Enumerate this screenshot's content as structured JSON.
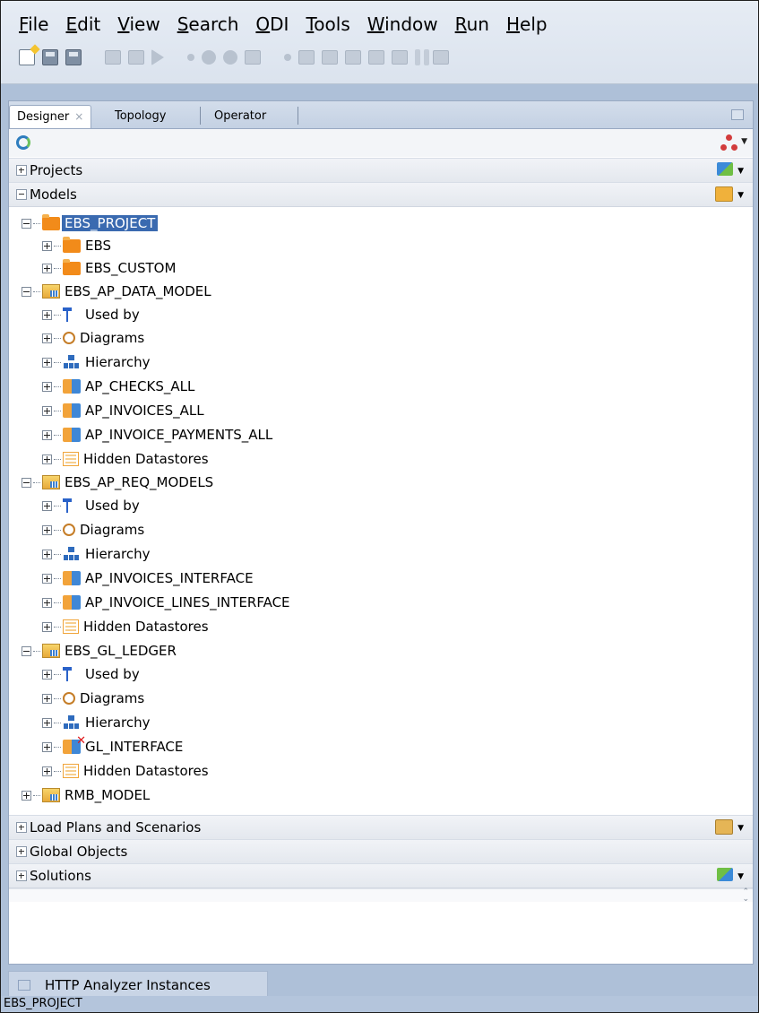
{
  "menu": [
    {
      "label": "File",
      "mnemonic": "F",
      "rest": "ile"
    },
    {
      "label": "Edit",
      "mnemonic": "E",
      "rest": "dit"
    },
    {
      "label": "View",
      "mnemonic": "V",
      "rest": "iew"
    },
    {
      "label": "Search",
      "mnemonic": "S",
      "rest": "earch"
    },
    {
      "label": "ODI",
      "mnemonic": "O",
      "rest": "DI"
    },
    {
      "label": "Tools",
      "mnemonic": "T",
      "rest": "ools"
    },
    {
      "label": "Window",
      "mnemonic": "W",
      "rest": "indow"
    },
    {
      "label": "Run",
      "mnemonic": "R",
      "rest": "un"
    },
    {
      "label": "Help",
      "mnemonic": "H",
      "rest": "elp"
    }
  ],
  "tabs": {
    "designer": "Designer",
    "designer_close": "×",
    "topology": "Topology",
    "operator": "Operator"
  },
  "sections": {
    "projects": "Projects",
    "models": "Models",
    "load_plans": "Load Plans and Scenarios",
    "global_objects": "Global Objects",
    "solutions": "Solutions"
  },
  "tree": {
    "ebs_project": "EBS_PROJECT",
    "ebs": "EBS",
    "ebs_custom": "EBS_CUSTOM",
    "ap_data_model": "EBS_AP_DATA_MODEL",
    "used_by": "Used by",
    "diagrams": "Diagrams",
    "hierarchy": "Hierarchy",
    "hidden_datastores": "Hidden Datastores",
    "ap_checks_all": "AP_CHECKS_ALL",
    "ap_invoices_all": "AP_INVOICES_ALL",
    "ap_invoice_payments_all": "AP_INVOICE_PAYMENTS_ALL",
    "ap_req_models": "EBS_AP_REQ_MODELS",
    "ap_invoices_interface": "AP_INVOICES_INTERFACE",
    "ap_invoice_lines_interface": "AP_INVOICE_LINES_INTERFACE",
    "gl_ledger": "EBS_GL_LEDGER",
    "gl_interface": "GL_INTERFACE",
    "rmb_model": "RMB_MODEL"
  },
  "secondary_tab": "HTTP Analyzer Instances",
  "status_bar": "EBS_PROJECT",
  "icons": {
    "toolbar": [
      "new-icon",
      "save-icon",
      "save-all-icon",
      "dim-icon",
      "dim-icon",
      "run-icon",
      "dot-icon",
      "debug-icon",
      "debug-icon",
      "dim-icon",
      "dot-icon",
      "dim-icon",
      "dim-icon",
      "dim-icon",
      "dim-icon",
      "dim-icon",
      "dim-icon",
      "pause-icon",
      "step-icon"
    ]
  },
  "colors": {
    "selection": "#3a6ab0",
    "chrome_bg": "#dbe3ee",
    "workspace_bg": "#aec0d8",
    "error_x": "#e0191b"
  }
}
